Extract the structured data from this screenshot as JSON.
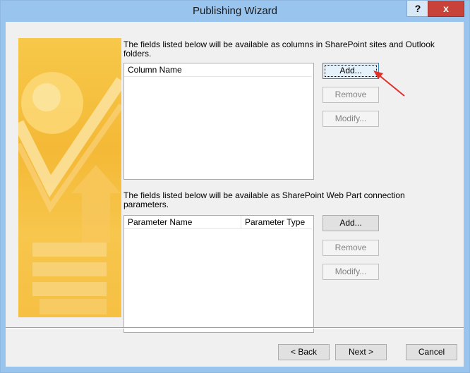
{
  "window": {
    "title": "Publishing Wizard",
    "help_label": "?",
    "close_label": "x"
  },
  "columns_section": {
    "description": "The fields listed below will be available as columns in SharePoint sites and Outlook folders.",
    "header": "Column Name",
    "add_label": "Add...",
    "remove_label": "Remove",
    "modify_label": "Modify..."
  },
  "params_section": {
    "description": "The fields listed below will be available as SharePoint Web Part connection parameters.",
    "header_name": "Parameter Name",
    "header_type": "Parameter Type",
    "add_label": "Add...",
    "remove_label": "Remove",
    "modify_label": "Modify..."
  },
  "footer": {
    "back_label": "< Back",
    "next_label": "Next >",
    "cancel_label": "Cancel"
  },
  "colors": {
    "titlebar": "#99c4ee",
    "close": "#c9423a",
    "banner": "#f5bd3c",
    "annotation_arrow": "#e0312b"
  }
}
